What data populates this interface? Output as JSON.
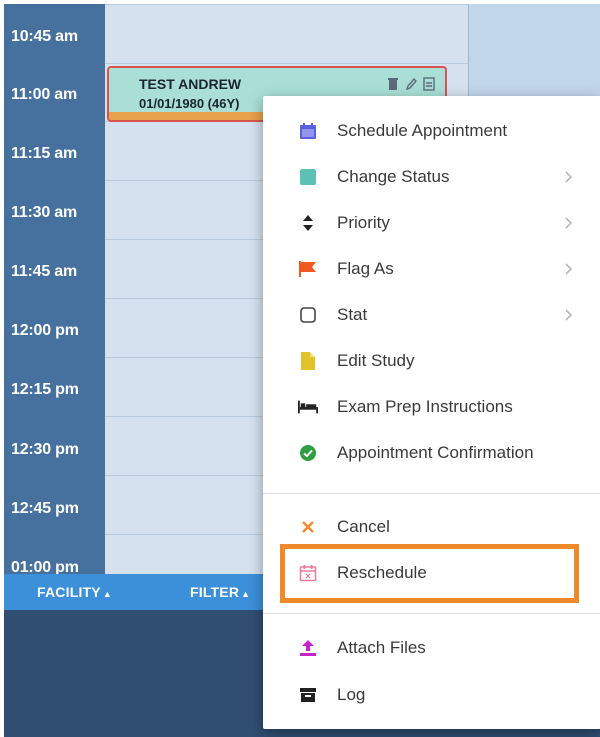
{
  "time_slots": [
    "10:45 am",
    "11:00 am",
    "11:15 am",
    "11:30 am",
    "11:45 am",
    "12:00 pm",
    "12:15 pm",
    "12:30 pm",
    "12:45 pm",
    "01:00 pm"
  ],
  "appointment": {
    "name": "TEST ANDREW",
    "dob": "01/01/1980 (46Y)"
  },
  "bottom_bar": {
    "facility_label": "FACILITY",
    "filter_label": "FILTER"
  },
  "menu": {
    "items": [
      {
        "label": "Schedule Appointment",
        "icon": "calendar-icon",
        "color": "#5a5fe0"
      },
      {
        "label": "Change Status",
        "icon": "status-square-icon",
        "color": "#5cc0b4"
      },
      {
        "label": "Priority",
        "icon": "sort-arrows-icon",
        "color": "#222222"
      },
      {
        "label": "Flag As",
        "icon": "flag-icon",
        "color": "#f05a22"
      },
      {
        "label": "Stat",
        "icon": "checkbox-icon",
        "color": "#444444"
      },
      {
        "label": "Edit Study",
        "icon": "document-icon",
        "color": "#e2c22a"
      },
      {
        "label": "Exam Prep Instructions",
        "icon": "bed-icon",
        "color": "#222222"
      },
      {
        "label": "Appointment Confirmation",
        "icon": "check-circle-icon",
        "color": "#2e9f3e"
      },
      {
        "label": "Cancel",
        "icon": "close-icon",
        "color": "#f08a2a"
      },
      {
        "label": "Reschedule",
        "icon": "calendar-x-icon",
        "color": "#f07a98"
      },
      {
        "label": "Attach Files",
        "icon": "upload-icon",
        "color": "#c822c8"
      },
      {
        "label": "Log",
        "icon": "archive-icon",
        "color": "#222222"
      }
    ]
  },
  "highlight_color": "#ef8a2b"
}
